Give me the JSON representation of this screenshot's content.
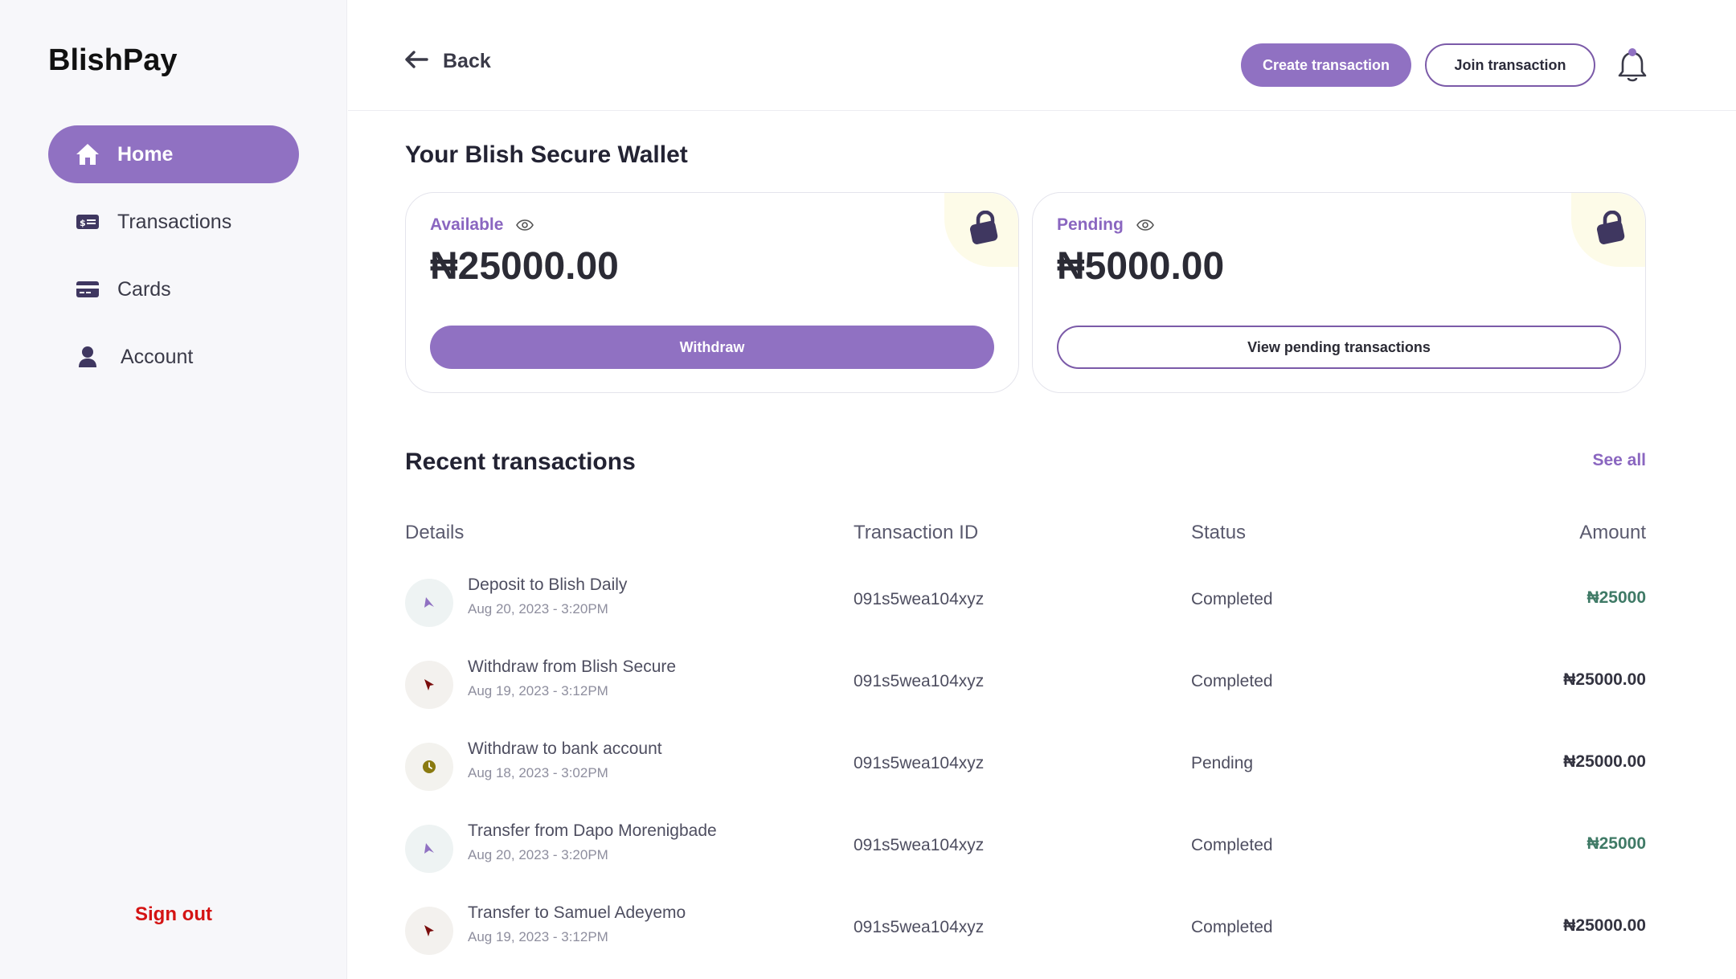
{
  "brand": "BlishPay",
  "sidebar": {
    "items": [
      {
        "label": "Home",
        "icon": "home-icon",
        "active": true
      },
      {
        "label": "Transactions",
        "icon": "transactions-icon",
        "active": false
      },
      {
        "label": "Cards",
        "icon": "card-icon",
        "active": false
      },
      {
        "label": "Account",
        "icon": "user-icon",
        "active": false
      }
    ],
    "sign_out": "Sign out"
  },
  "topbar": {
    "back_label": "Back",
    "create_label": "Create transaction",
    "join_label": "Join transaction"
  },
  "wallet": {
    "title": "Your Blish Secure Wallet",
    "available": {
      "label": "Available",
      "amount": "₦25000.00",
      "action": "Withdraw"
    },
    "pending": {
      "label": "Pending",
      "amount": "₦5000.00",
      "action": "View pending transactions"
    }
  },
  "recent": {
    "title": "Recent transactions",
    "see_all": "See all",
    "headers": {
      "details": "Details",
      "txid": "Transaction ID",
      "status": "Status",
      "amount": "Amount"
    },
    "rows": [
      {
        "title": "Deposit to Blish Daily",
        "date": "Aug 20, 2023 - 3:20PM",
        "txid": "091s5wea104xyz",
        "status": "Completed",
        "amount": "₦25000",
        "type": "credit"
      },
      {
        "title": "Withdraw from Blish Secure",
        "date": "Aug 19, 2023 - 3:12PM",
        "txid": "091s5wea104xyz",
        "status": "Completed",
        "amount": "₦25000.00",
        "type": "debit"
      },
      {
        "title": "Withdraw to bank account",
        "date": "Aug 18, 2023 - 3:02PM",
        "txid": "091s5wea104xyz",
        "status": "Pending",
        "amount": "₦25000.00",
        "type": "pending"
      },
      {
        "title": "Transfer from Dapo Morenigbade",
        "date": "Aug 20, 2023 - 3:20PM",
        "txid": "091s5wea104xyz",
        "status": "Completed",
        "amount": "₦25000",
        "type": "credit"
      },
      {
        "title": "Transfer to Samuel Adeyemo",
        "date": "Aug 19, 2023 - 3:12PM",
        "txid": "091s5wea104xyz",
        "status": "Completed",
        "amount": "₦25000.00",
        "type": "debit"
      }
    ]
  },
  "colors": {
    "accent": "#9071c2",
    "signout": "#d41414",
    "credit": "#3f7a66"
  }
}
